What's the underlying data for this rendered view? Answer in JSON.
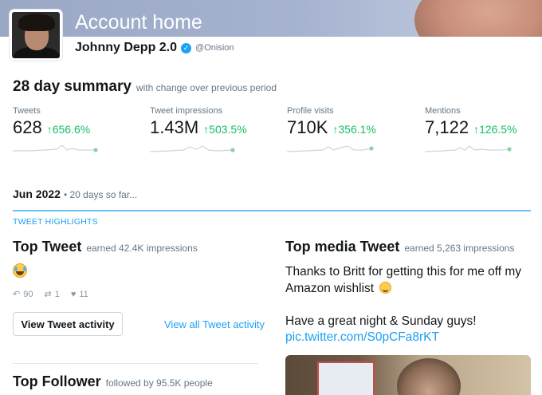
{
  "header": {
    "title": "Account home",
    "name": "Johnny Depp 2.0",
    "verified_glyph": "✓",
    "handle": "@Onision"
  },
  "summary": {
    "title": "28 day summary",
    "subtitle": "with change over previous period",
    "stats": [
      {
        "label": "Tweets",
        "value": "628",
        "change": "↑656.6%"
      },
      {
        "label": "Tweet impressions",
        "value": "1.43M",
        "change": "↑503.5%"
      },
      {
        "label": "Profile visits",
        "value": "710K",
        "change": "↑356.1%"
      },
      {
        "label": "Mentions",
        "value": "7,122",
        "change": "↑126.5%"
      }
    ]
  },
  "period": {
    "month": "Jun 2022",
    "days": "• 20 days so far..."
  },
  "highlights": {
    "label": "TWEET HIGHLIGHTS",
    "top_tweet": {
      "title": "Top Tweet",
      "subtitle": "earned 42.4K impressions",
      "emoji": "laughing-crying-emoji",
      "replies": "90",
      "retweets": "1",
      "likes": "11",
      "button_label": "View Tweet activity",
      "link_label": "View all Tweet activity"
    },
    "top_media": {
      "title": "Top media Tweet",
      "subtitle": "earned 5,263 impressions",
      "text_line1": "Thanks to Britt for getting this for me off my Amazon wishlist",
      "text_line2": "Have a great night & Sunday guys!",
      "link": "pic.twitter.com/S0pCFa8rKT"
    },
    "top_follower": {
      "title": "Top Follower",
      "subtitle": "followed by 95.5K people"
    }
  },
  "colors": {
    "accent": "#1da1f2",
    "positive": "#17bf63",
    "muted": "#657786"
  }
}
